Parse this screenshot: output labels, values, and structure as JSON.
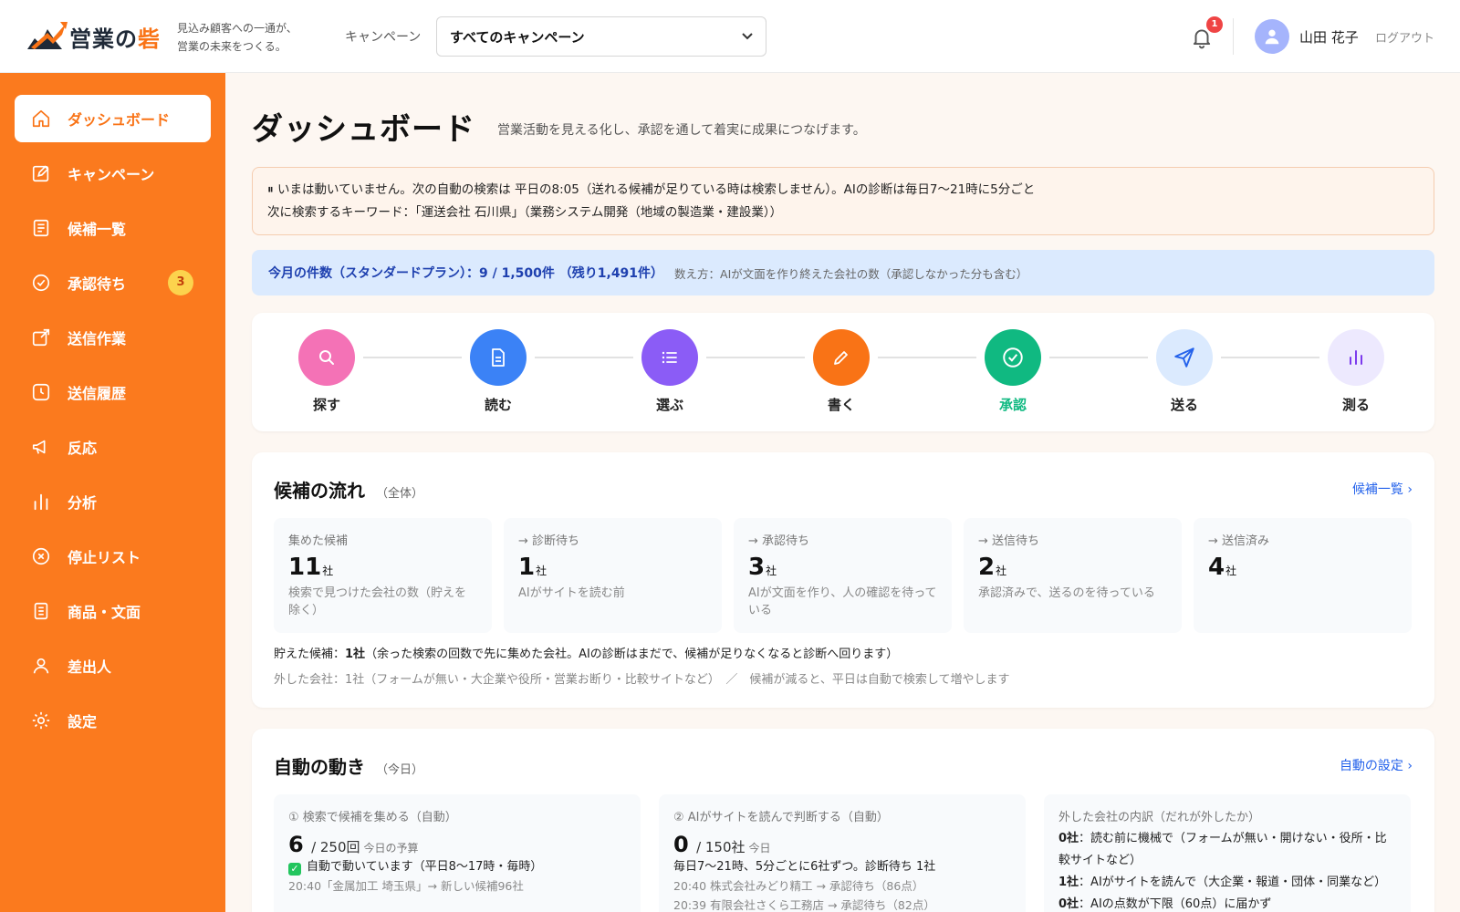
{
  "header": {
    "logo_text": "営業の",
    "logo_accent": "砦",
    "tagline_1": "見込み顧客への一通が、",
    "tagline_2": "営業の未来をつくる。",
    "campaign_label": "キャンペーン",
    "campaign_selected": "すべてのキャンペーン",
    "notification_count": "1",
    "user_name": "山田 花子",
    "logout": "ログアウト"
  },
  "sidebar": {
    "items": [
      {
        "label": "ダッシュボード",
        "icon": "home-icon"
      },
      {
        "label": "キャンペーン",
        "icon": "edit-icon"
      },
      {
        "label": "候補一覧",
        "icon": "list-icon"
      },
      {
        "label": "承認待ち",
        "icon": "check-circle-icon",
        "badge": "3"
      },
      {
        "label": "送信作業",
        "icon": "external-link-icon"
      },
      {
        "label": "送信履歴",
        "icon": "clock-icon"
      },
      {
        "label": "反応",
        "icon": "megaphone-icon"
      },
      {
        "label": "分析",
        "icon": "bar-chart-icon"
      },
      {
        "label": "停止リスト",
        "icon": "x-circle-icon"
      },
      {
        "label": "商品・文面",
        "icon": "document-icon"
      },
      {
        "label": "差出人",
        "icon": "user-icon"
      },
      {
        "label": "設定",
        "icon": "sun-gear-icon"
      }
    ]
  },
  "page": {
    "title": "ダッシュボード",
    "subtitle": "営業活動を見える化し、承認を通して着実に成果につなげます。"
  },
  "notice": {
    "line1": "⏸ いまは動いていません。次の自動の検索は 平日の8:05（送れる候補が足りている時は検索しません）。AIの診断は毎日7〜21時に5分ごと",
    "line2": "次に検索するキーワード：「運送会社 石川県」（業務システム開発（地域の製造業・建設業））"
  },
  "usage": {
    "main": "今月の件数（スタンダードプラン）：9 / 1,500件 （残り1,491件）",
    "note": "数え方：AIが文面を作り終えた会社の数（承認しなかった分も含む）"
  },
  "pipeline": {
    "steps": [
      {
        "label": "探す",
        "color": "#f472b6",
        "icon": "search-icon"
      },
      {
        "label": "読む",
        "color": "#3b82f6",
        "icon": "file-icon"
      },
      {
        "label": "選ぶ",
        "color": "#8b5cf6",
        "icon": "list-icon"
      },
      {
        "label": "書く",
        "color": "#f97316",
        "icon": "pencil-icon"
      },
      {
        "label": "承認",
        "color": "#10b981",
        "icon": "check-icon",
        "active": true
      },
      {
        "label": "送る",
        "color": "#dbeafe",
        "icon": "send-icon"
      },
      {
        "label": "測る",
        "color": "#ede9fe",
        "icon": "bar-chart-icon"
      }
    ]
  },
  "flow": {
    "title": "候補の流れ",
    "scope": "（全体）",
    "link": "候補一覧 ›",
    "stages": [
      {
        "label": "集めた候補",
        "num": "11",
        "unit": "社",
        "desc": "検索で見つけた会社の数（貯えを除く）"
      },
      {
        "label": "→ 診断待ち",
        "num": "1",
        "unit": "社",
        "desc": "AIがサイトを読む前"
      },
      {
        "label": "→ 承認待ち",
        "num": "3",
        "unit": "社",
        "desc": "AIが文面を作り、人の確認を待っている"
      },
      {
        "label": "→ 送信待ち",
        "num": "2",
        "unit": "社",
        "desc": "承認済みで、送るのを待っている"
      },
      {
        "label": "→ 送信済み",
        "num": "4",
        "unit": "社",
        "desc": ""
      }
    ],
    "note1_prefix": "貯えた候補：",
    "note1_bold": "1社",
    "note1_rest": "（余った検索の回数で先に集めた会社。AIの診断はまだで、候補が足りなくなると診断へ回ります）",
    "note2": "外した会社：1社（フォームが無い・大企業や役所・営業お断り・比較サイトなど）　／　候補が減ると、平日は自動で検索して増やします"
  },
  "auto": {
    "title": "自動の動き",
    "scope": "（今日）",
    "link": "自動の設定 ›",
    "box1": {
      "label": "① 検索で候補を集める（自動）",
      "num": "6",
      "total": "/ 250回",
      "sub": "今日の予算",
      "status": "自動で動いています（平日8〜17時・毎時）",
      "log1": "20:40「金属加工 埼玉県」→ 新しい候補96社"
    },
    "box2": {
      "label": "② AIがサイトを読んで判断する（自動）",
      "num": "0",
      "total": "/ 150社",
      "sub": "今日",
      "status": "毎日7〜21時、5分ごとに6社ずつ。診断待ち 1社",
      "log1": "20:40 株式会社みどり精工 → 承認待ち（86点）",
      "log2": "20:39 有限会社さくら工務店 → 承認待ち（82点）"
    },
    "box3": {
      "label": "外した会社の内訳（だれが外したか）",
      "row1_bold": "0社",
      "row1": "：読む前に機械で（フォームが無い・開けない・役所・比較サイトなど）",
      "row2_bold": "1社",
      "row2": "：AIがサイトを読んで（大企業・報道・団体・同業など）",
      "row3_bold": "0社",
      "row3": "：AIの点数が下限（60点）に届かず"
    }
  }
}
